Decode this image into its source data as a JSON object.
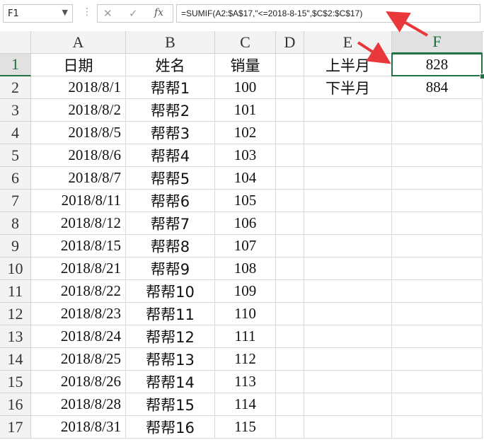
{
  "formula_bar": {
    "name_box": "F1",
    "cancel_glyph": "✕",
    "enter_glyph": "✓",
    "fx_label": "fx",
    "formula": "=SUMIF(A2:$A$17,\"<=2018-8-15\",$C$2:$C$17)"
  },
  "columns": [
    "A",
    "B",
    "C",
    "D",
    "E",
    "F"
  ],
  "rows": [
    {
      "n": "1",
      "a": "日期",
      "b": "姓名",
      "c": "销量",
      "e": "上半月",
      "f": "828"
    },
    {
      "n": "2",
      "a": "2018/8/1",
      "b": "帮帮1",
      "c": "100",
      "e": "下半月",
      "f": "884"
    },
    {
      "n": "3",
      "a": "2018/8/2",
      "b": "帮帮2",
      "c": "101"
    },
    {
      "n": "4",
      "a": "2018/8/5",
      "b": "帮帮3",
      "c": "102"
    },
    {
      "n": "5",
      "a": "2018/8/6",
      "b": "帮帮4",
      "c": "103"
    },
    {
      "n": "6",
      "a": "2018/8/7",
      "b": "帮帮5",
      "c": "104"
    },
    {
      "n": "7",
      "a": "2018/8/11",
      "b": "帮帮6",
      "c": "105"
    },
    {
      "n": "8",
      "a": "2018/8/12",
      "b": "帮帮7",
      "c": "106"
    },
    {
      "n": "9",
      "a": "2018/8/15",
      "b": "帮帮8",
      "c": "107"
    },
    {
      "n": "10",
      "a": "2018/8/21",
      "b": "帮帮9",
      "c": "108"
    },
    {
      "n": "11",
      "a": "2018/8/22",
      "b": "帮帮10",
      "c": "109"
    },
    {
      "n": "12",
      "a": "2018/8/23",
      "b": "帮帮11",
      "c": "110"
    },
    {
      "n": "13",
      "a": "2018/8/24",
      "b": "帮帮12",
      "c": "111"
    },
    {
      "n": "14",
      "a": "2018/8/25",
      "b": "帮帮13",
      "c": "112"
    },
    {
      "n": "15",
      "a": "2018/8/26",
      "b": "帮帮14",
      "c": "113"
    },
    {
      "n": "16",
      "a": "2018/8/28",
      "b": "帮帮15",
      "c": "114"
    },
    {
      "n": "17",
      "a": "2018/8/31",
      "b": "帮帮16",
      "c": "115"
    }
  ],
  "selected_cell": "F1",
  "colors": {
    "accent": "#217346",
    "arrow": "#e8383b"
  }
}
